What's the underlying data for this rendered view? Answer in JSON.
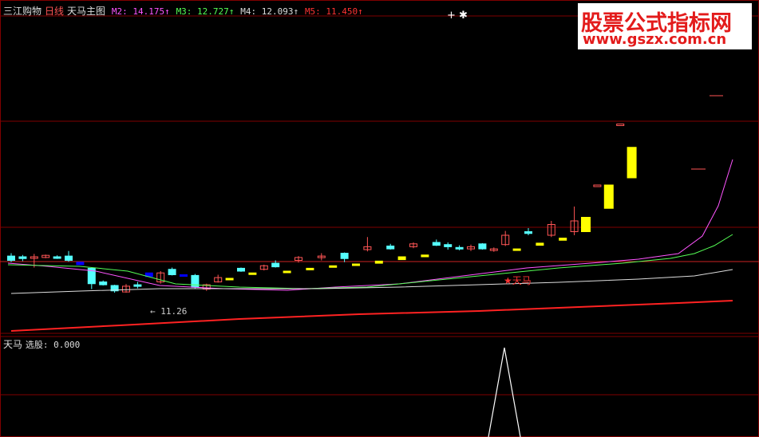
{
  "header": {
    "app_name": "三江购物",
    "period": "日线",
    "indicator": "天马主图",
    "ma_items": [
      {
        "label": "M2: 14.175↑",
        "color": "#ff55ff"
      },
      {
        "label": "M3: 12.727↑",
        "color": "#55ff55"
      },
      {
        "label": "M4: 12.093↑",
        "color": "#dddddd"
      },
      {
        "label": "M5: 11.450↑",
        "color": "#ff3333"
      }
    ]
  },
  "sub_panel": {
    "title": "天马",
    "value_label": "选股: 0.000"
  },
  "annotations": {
    "low_label": "← 11.26",
    "signal_label": "★天马",
    "top_marks": "+ ✱"
  },
  "watermark": {
    "line1": "股票公式指标网",
    "line2": "www.gszx.com.cn"
  },
  "colors": {
    "up": "#ff5555",
    "down": "#55ffff",
    "yellow": "#ffff00",
    "blue": "#0000ff",
    "grid": "#800000",
    "ma_fast": "#ff55ff",
    "ma_mid": "#55ff55",
    "ma_slow": "#dddddd",
    "ma_long": "#ff2222"
  },
  "chart_data": {
    "type": "candlestick",
    "candles": [
      {
        "o": 0.42,
        "c": 0.3,
        "h": 0.5,
        "l": 0.25,
        "s": "down"
      },
      {
        "o": 0.4,
        "c": 0.35,
        "h": 0.45,
        "l": 0.28,
        "s": "down"
      },
      {
        "o": 0.36,
        "c": 0.4,
        "h": 0.48,
        "l": 0.1,
        "s": "up"
      },
      {
        "o": 0.38,
        "c": 0.44,
        "h": 0.46,
        "l": 0.36,
        "s": "up"
      },
      {
        "o": 0.4,
        "c": 0.36,
        "h": 0.44,
        "l": 0.34,
        "s": "down"
      },
      {
        "o": 0.42,
        "c": 0.3,
        "h": 0.56,
        "l": 0.26,
        "s": "down"
      },
      {
        "o": 0.25,
        "c": 0.18,
        "h": 0.28,
        "l": 0.15,
        "s": "blue"
      },
      {
        "o": 0.08,
        "c": -0.35,
        "h": 0.1,
        "l": -0.5,
        "s": "down"
      },
      {
        "o": -0.3,
        "c": -0.38,
        "h": -0.26,
        "l": -0.4,
        "s": "down"
      },
      {
        "o": -0.4,
        "c": -0.55,
        "h": -0.38,
        "l": -0.6,
        "s": "down"
      },
      {
        "o": -0.58,
        "c": -0.42,
        "h": -0.36,
        "l": -0.6,
        "s": "up"
      },
      {
        "o": -0.4,
        "c": -0.38,
        "h": -0.3,
        "l": -0.48,
        "s": "down"
      },
      {
        "o": -0.05,
        "c": -0.15,
        "h": 0.0,
        "l": -0.2,
        "s": "blue"
      },
      {
        "o": -0.3,
        "c": -0.05,
        "h": 0.0,
        "l": -0.35,
        "s": "up"
      },
      {
        "o": 0.05,
        "c": -0.1,
        "h": 0.1,
        "l": -0.12,
        "s": "down"
      },
      {
        "o": -0.1,
        "c": -0.12,
        "h": 0.0,
        "l": -0.15,
        "s": "blue"
      },
      {
        "o": -0.12,
        "c": -0.45,
        "h": -0.08,
        "l": -0.48,
        "s": "down"
      },
      {
        "o": -0.5,
        "c": -0.38,
        "h": -0.35,
        "l": -0.55,
        "s": "up"
      },
      {
        "o": -0.3,
        "c": -0.18,
        "h": -0.1,
        "l": -0.32,
        "s": "up"
      },
      {
        "o": -0.2,
        "c": -0.22,
        "h": -0.18,
        "l": -0.24,
        "s": "yellow"
      },
      {
        "o": 0.08,
        "c": 0.0,
        "h": 0.1,
        "l": -0.02,
        "s": "down"
      },
      {
        "o": -0.05,
        "c": -0.08,
        "h": -0.03,
        "l": -0.1,
        "s": "yellow"
      },
      {
        "o": 0.05,
        "c": 0.15,
        "h": 0.18,
        "l": 0.02,
        "s": "up"
      },
      {
        "o": 0.22,
        "c": 0.12,
        "h": 0.3,
        "l": 0.1,
        "s": "down"
      },
      {
        "o": 0.0,
        "c": -0.03,
        "h": 0.02,
        "l": -0.05,
        "s": "yellow"
      },
      {
        "o": 0.3,
        "c": 0.38,
        "h": 0.42,
        "l": 0.24,
        "s": "up"
      },
      {
        "o": 0.08,
        "c": 0.04,
        "h": 0.1,
        "l": 0.02,
        "s": "yellow"
      },
      {
        "o": 0.42,
        "c": 0.42,
        "h": 0.5,
        "l": 0.3,
        "s": "up"
      },
      {
        "o": 0.15,
        "c": 0.12,
        "h": 0.16,
        "l": 0.1,
        "s": "yellow"
      },
      {
        "o": 0.35,
        "c": 0.5,
        "h": 0.52,
        "l": 0.25,
        "s": "down"
      },
      {
        "o": 0.2,
        "c": 0.16,
        "h": 0.22,
        "l": 0.14,
        "s": "yellow"
      },
      {
        "o": 0.6,
        "c": 0.68,
        "h": 0.95,
        "l": 0.55,
        "s": "up"
      },
      {
        "o": 0.28,
        "c": 0.22,
        "h": 0.3,
        "l": 0.2,
        "s": "yellow"
      },
      {
        "o": 0.7,
        "c": 0.62,
        "h": 0.76,
        "l": 0.6,
        "s": "down"
      },
      {
        "o": 0.4,
        "c": 0.32,
        "h": 0.42,
        "l": 0.3,
        "s": "yellow"
      },
      {
        "o": 0.68,
        "c": 0.76,
        "h": 0.8,
        "l": 0.64,
        "s": "up"
      },
      {
        "o": 0.45,
        "c": 0.4,
        "h": 0.48,
        "l": 0.38,
        "s": "yellow"
      },
      {
        "o": 0.8,
        "c": 0.72,
        "h": 0.88,
        "l": 0.7,
        "s": "down"
      },
      {
        "o": 0.74,
        "c": 0.68,
        "h": 0.8,
        "l": 0.6,
        "s": "down"
      },
      {
        "o": 0.66,
        "c": 0.62,
        "h": 0.72,
        "l": 0.58,
        "s": "down"
      },
      {
        "o": 0.62,
        "c": 0.68,
        "h": 0.74,
        "l": 0.56,
        "s": "up"
      },
      {
        "o": 0.76,
        "c": 0.62,
        "h": 0.78,
        "l": 0.6,
        "s": "down"
      },
      {
        "o": 0.58,
        "c": 0.62,
        "h": 0.66,
        "l": 0.54,
        "s": "up"
      },
      {
        "o": 0.74,
        "c": 1.0,
        "h": 1.12,
        "l": 0.7,
        "s": "up"
      },
      {
        "o": 0.62,
        "c": 0.58,
        "h": 0.64,
        "l": 0.56,
        "s": "yellow"
      },
      {
        "o": 1.1,
        "c": 1.05,
        "h": 1.2,
        "l": 1.0,
        "s": "down"
      },
      {
        "o": 0.78,
        "c": 0.72,
        "h": 0.8,
        "l": 0.7,
        "s": "yellow"
      },
      {
        "o": 1.0,
        "c": 1.3,
        "h": 1.4,
        "l": 0.95,
        "s": "up"
      },
      {
        "o": 0.92,
        "c": 0.86,
        "h": 0.94,
        "l": 0.84,
        "s": "yellow"
      },
      {
        "o": 1.1,
        "c": 1.4,
        "h": 1.8,
        "l": 1.0,
        "s": "up"
      },
      {
        "o": 1.1,
        "c": 1.5,
        "h": 1.5,
        "l": 1.1,
        "s": "yellow"
      },
      {
        "o": 2.4,
        "c": 2.4,
        "h": 2.4,
        "l": 2.4,
        "s": "up"
      },
      {
        "o": 1.75,
        "c": 2.4,
        "h": 2.4,
        "l": 1.75,
        "s": "yellow"
      },
      {
        "o": 4.1,
        "c": 4.1,
        "h": 4.1,
        "l": 4.1,
        "s": "up"
      },
      {
        "o": 2.6,
        "c": 3.45,
        "h": 3.45,
        "l": 2.6,
        "s": "yellow"
      }
    ],
    "sub_signal": {
      "type": "line",
      "peak_index": 45,
      "value": 1
    }
  }
}
